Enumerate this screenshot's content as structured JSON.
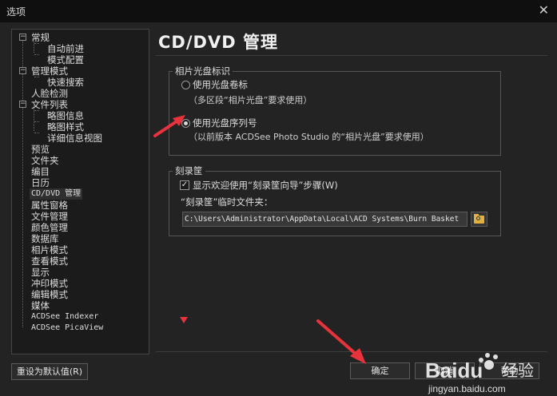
{
  "window": {
    "title": "选项"
  },
  "tree": {
    "items": [
      {
        "label": "常规"
      },
      {
        "label": "自动前进"
      },
      {
        "label": "模式配置"
      },
      {
        "label": "管理模式"
      },
      {
        "label": "快速搜索"
      },
      {
        "label": "人脸检测"
      },
      {
        "label": "文件列表"
      },
      {
        "label": "略图信息"
      },
      {
        "label": "略图样式"
      },
      {
        "label": "详细信息视图"
      },
      {
        "label": "预览"
      },
      {
        "label": "文件夹"
      },
      {
        "label": "编目"
      },
      {
        "label": "日历"
      },
      {
        "label": "CD/DVD 管理"
      },
      {
        "label": "属性窗格"
      },
      {
        "label": "文件管理"
      },
      {
        "label": "颜色管理"
      },
      {
        "label": "数据库"
      },
      {
        "label": "相片模式"
      },
      {
        "label": "查看模式"
      },
      {
        "label": "显示"
      },
      {
        "label": "冲印模式"
      },
      {
        "label": "编辑模式"
      },
      {
        "label": "媒体"
      },
      {
        "label": "ACDSee Indexer"
      },
      {
        "label": "ACDSee PicaView"
      }
    ],
    "selected": "CD/DVD 管理"
  },
  "panel": {
    "heading": "CD/DVD 管理",
    "disc_group": {
      "title": "相片光盘标识",
      "option_label": {
        "label": "使用光盘卷标",
        "note": "（多区段“相片光盘”要求使用）",
        "selected": false
      },
      "option_serial": {
        "label": "使用光盘序列号",
        "note": "（以前版本 ACDSee Photo Studio 的“相片光盘”要求使用）",
        "selected": true
      }
    },
    "burn_group": {
      "title": "刻录筐",
      "welcome_checkbox": {
        "label": "显示欢迎使用“刻录筐向导”步骤(W)",
        "checked": true
      },
      "temp_folder_label": "“刻录筐”临时文件夹：",
      "temp_folder_value": "C:\\Users\\Administrator\\AppData\\Local\\ACD Systems\\Burn Basket"
    }
  },
  "buttons": {
    "reset": "重设为默认值(R)",
    "ok": "确定",
    "cancel": "取消",
    "help": "帮助"
  },
  "watermark": {
    "brand": "Baidu",
    "subtitle": "jingyan.baidu.com",
    "tag": "经验"
  },
  "colors": {
    "annotation_arrow": "#e8323c",
    "folder_icon": "#e0b040",
    "background": "#232323"
  }
}
